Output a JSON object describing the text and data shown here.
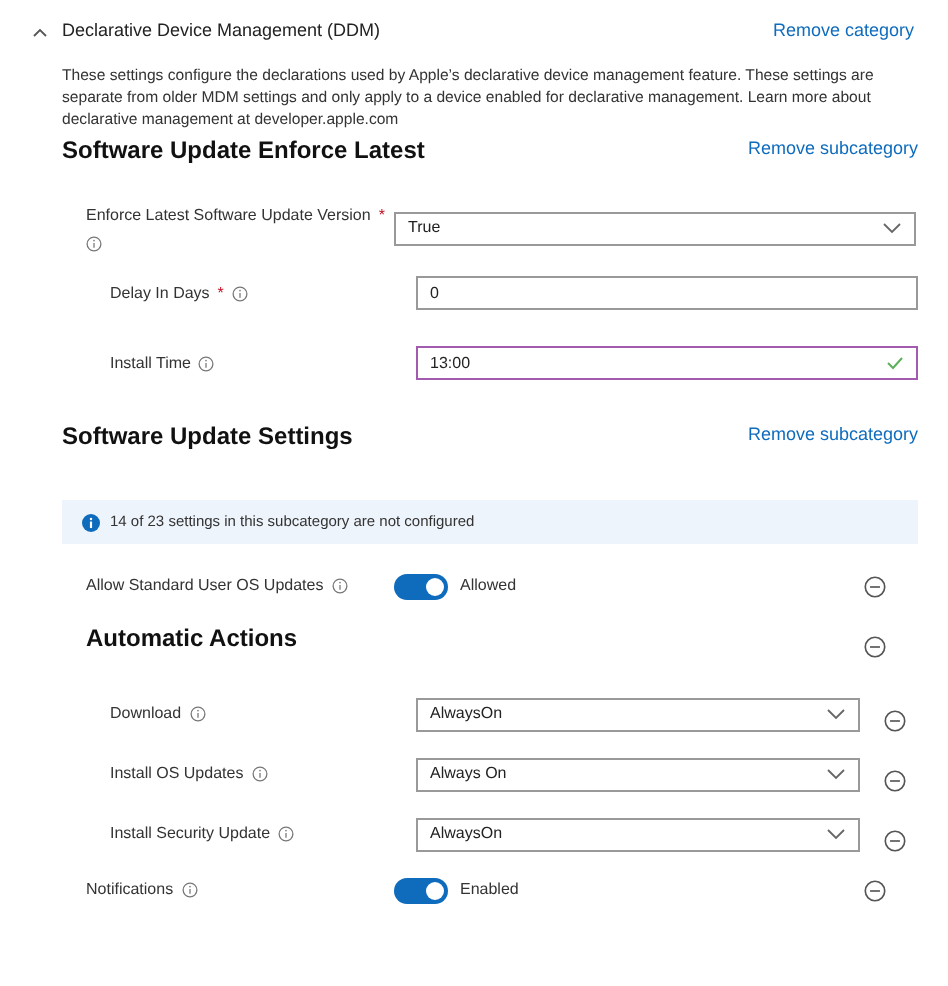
{
  "category": {
    "title": "Declarative Device Management (DDM)",
    "expanded": true,
    "remove_link": "Remove category",
    "description": "These settings configure the declarations used by Apple’s declarative device management feature. These settings are separate from older MDM settings and only apply to a device enabled for declarative management. Learn more about declarative management at developer.apple.com"
  },
  "subcategories": [
    {
      "title": "Software Update Enforce Latest",
      "remove_link": "Remove subcategory",
      "settings": [
        {
          "kind": "select",
          "label": "Enforce Latest Software Update Version",
          "required_mark": "*",
          "value": "True"
        },
        {
          "kind": "text",
          "label": "Delay In Days",
          "required_mark": "*",
          "value": "0",
          "validated": false
        },
        {
          "kind": "text",
          "label": "Install Time",
          "value": "13:00",
          "validated": true
        }
      ]
    },
    {
      "title": "Software Update Settings",
      "remove_link": "Remove subcategory",
      "notice": "14 of 23 settings in this subcategory are not configured",
      "settings": [
        {
          "kind": "toggle",
          "label": "Allow Standard User OS Updates",
          "on": true,
          "state_label": "Allowed"
        },
        {
          "kind": "group",
          "label": "Automatic Actions",
          "children": [
            {
              "kind": "select",
              "label": "Download",
              "value": "AlwaysOn"
            },
            {
              "kind": "select",
              "label": "Install OS Updates",
              "value": "Always On"
            },
            {
              "kind": "select",
              "label": "Install Security Update",
              "value": "AlwaysOn"
            }
          ]
        },
        {
          "kind": "toggle",
          "label": "Notifications",
          "on": true,
          "state_label": "Enabled"
        }
      ]
    }
  ]
}
